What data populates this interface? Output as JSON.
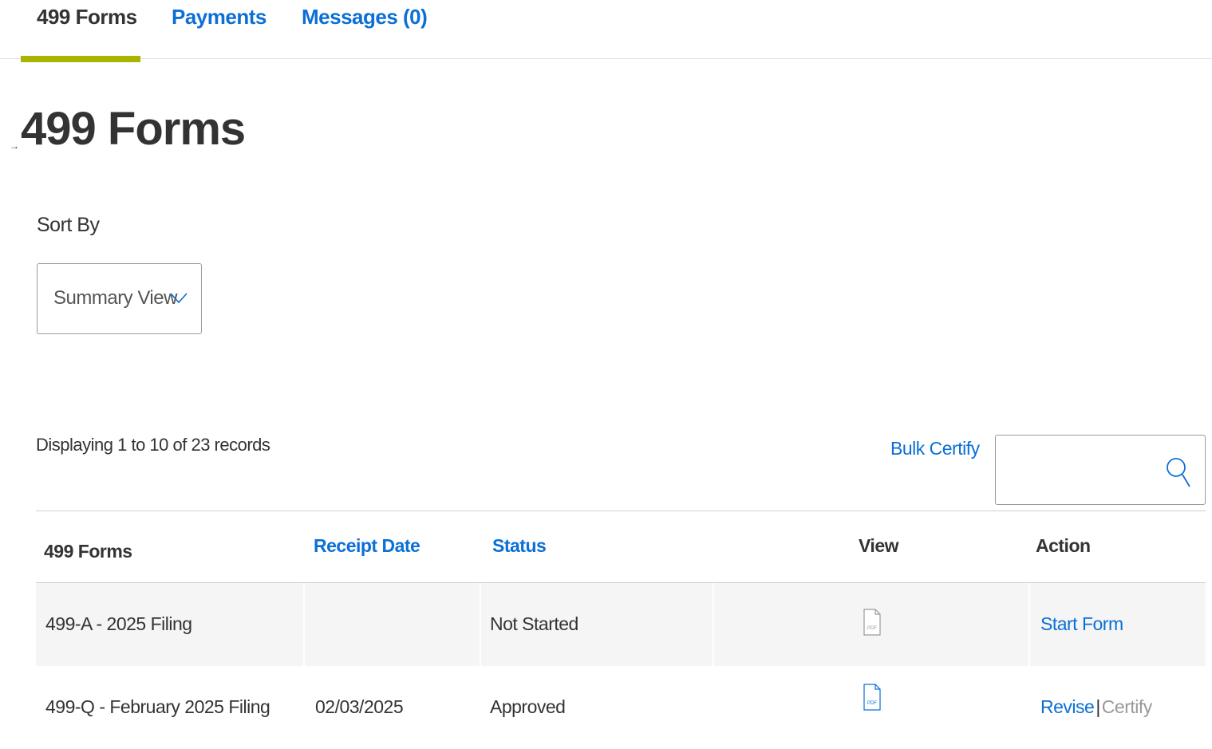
{
  "tabs": [
    {
      "label": "499 Forms"
    },
    {
      "label": "Payments"
    },
    {
      "label": "Messages (0)"
    }
  ],
  "page": {
    "title": "499 Forms"
  },
  "sort": {
    "label": "Sort By",
    "selected": "Summary View"
  },
  "records": {
    "summary": "Displaying 1 to 10 of 23 records"
  },
  "toolbar": {
    "bulk_certify": "Bulk Certify"
  },
  "search": {
    "placeholder": "",
    "value": ""
  },
  "table": {
    "columns": [
      {
        "label": "499 Forms"
      },
      {
        "label": "Receipt Date"
      },
      {
        "label": "Status"
      },
      {
        "label": "View"
      },
      {
        "label": "Action"
      }
    ],
    "rows": [
      {
        "form": "499-A - 2025 Filing",
        "receipt_date": "",
        "status": "Not Started",
        "view_icon": "pdf-icon",
        "actions": [
          {
            "label": "Start Form"
          }
        ]
      },
      {
        "form": "499-Q - February 2025 Filing",
        "receipt_date": "02/03/2025",
        "status": "Approved",
        "view_icon": "pdf-icon",
        "actions": [
          {
            "label": "Revise"
          },
          {
            "label": "|"
          },
          {
            "label": "Certify"
          }
        ]
      }
    ]
  },
  "colors": {
    "link": "#0b6fd6",
    "tab_indicator": "#a8b400",
    "text": "#333333",
    "row_shade": "#f5f5f5"
  }
}
